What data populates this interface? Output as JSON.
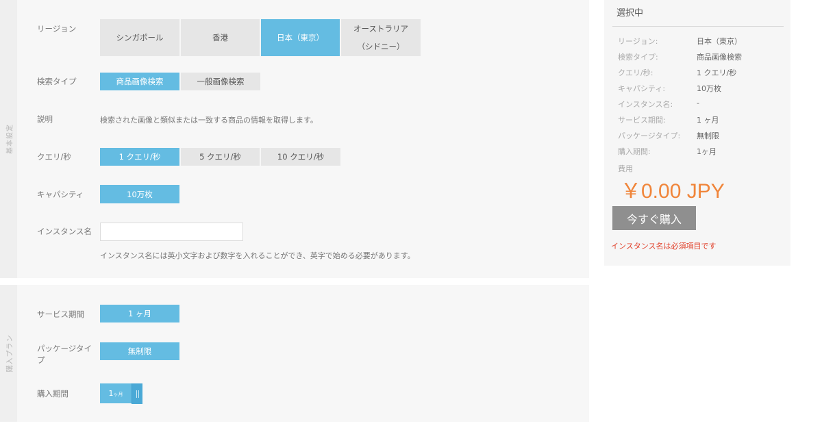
{
  "basic": {
    "side_label": "基本設定",
    "region": {
      "label": "リージョン",
      "options": [
        {
          "text": "シンガポール",
          "active": false
        },
        {
          "text": "香港",
          "active": false
        },
        {
          "text": "日本（東京）",
          "active": true
        },
        {
          "text": "オーストラリア（シドニー）",
          "active": false
        }
      ]
    },
    "search_type": {
      "label": "検索タイプ",
      "options": [
        {
          "text": "商品画像検索",
          "active": true
        },
        {
          "text": "一般画像検索",
          "active": false
        }
      ]
    },
    "description": {
      "label": "説明",
      "text": "検索された画像と類似または一致する商品の情報を取得します。"
    },
    "qps": {
      "label": "クエリ/秒",
      "options": [
        {
          "text": "1 クエリ/秒",
          "active": true
        },
        {
          "text": "5 クエリ/秒",
          "active": false
        },
        {
          "text": "10 クエリ/秒",
          "active": false
        }
      ]
    },
    "capacity": {
      "label": "キャパシティ",
      "options": [
        {
          "text": "10万枚",
          "active": true
        }
      ]
    },
    "instance": {
      "label": "インスタンス名",
      "value": "",
      "hint": "インスタンス名には英小文字および数字を入れることができ、英字で始める必要があります。"
    }
  },
  "plan": {
    "side_label": "購入プラン",
    "service_period": {
      "label": "サービス期間",
      "value": "1 ヶ月"
    },
    "package_type": {
      "label": "パッケージタイプ",
      "value": "無制限"
    },
    "purchase_period": {
      "label": "購入期間",
      "value_num": "1",
      "value_unit": "ヶ月"
    }
  },
  "summary": {
    "title": "選択中",
    "rows": [
      {
        "k": "リージョン:",
        "v": "日本（東京）"
      },
      {
        "k": "検索タイプ:",
        "v": "商品画像検索"
      },
      {
        "k": "クエリ/秒:",
        "v": "1 クエリ/秒"
      },
      {
        "k": "キャパシティ:",
        "v": "10万枚"
      },
      {
        "k": "インスタンス名:",
        "v": "-"
      },
      {
        "k": "サービス期間:",
        "v": "1 ヶ月"
      },
      {
        "k": "パッケージタイプ:",
        "v": "無制限"
      },
      {
        "k": "購入期間:",
        "v": "1ヶ月"
      }
    ],
    "cost_label": "費用",
    "price": "￥0.00 JPY",
    "buy_label": "今すぐ購入",
    "error": "インスタンス名は必須項目です"
  },
  "colors": {
    "active": "#64bce2",
    "price": "#f0853a",
    "error": "#e1422c"
  }
}
